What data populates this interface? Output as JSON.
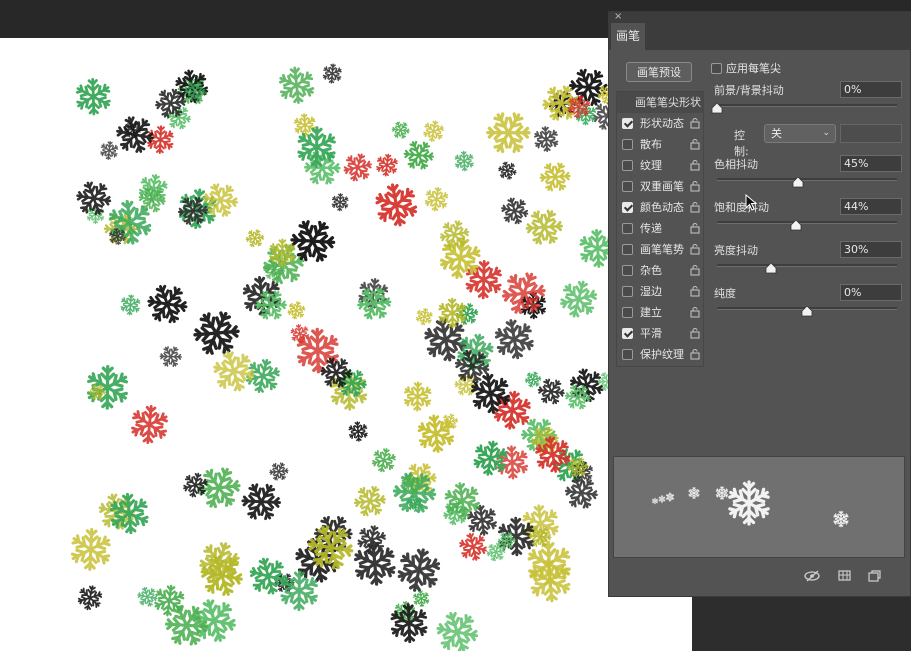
{
  "panel": {
    "tab_title": "画笔",
    "close_glyph": "×",
    "preset_button": "画笔预设",
    "brush_tip_shape": "画笔笔尖形状",
    "items": [
      {
        "label": "形状动态",
        "checked": true
      },
      {
        "label": "散布",
        "checked": false
      },
      {
        "label": "纹理",
        "checked": false
      },
      {
        "label": "双重画笔",
        "checked": false
      },
      {
        "label": "颜色动态",
        "checked": true
      },
      {
        "label": "传递",
        "checked": false
      },
      {
        "label": "画笔笔势",
        "checked": false
      },
      {
        "label": "杂色",
        "checked": false
      },
      {
        "label": "湿边",
        "checked": false
      },
      {
        "label": "建立",
        "checked": false
      },
      {
        "label": "平滑",
        "checked": true
      },
      {
        "label": "保护纹理",
        "checked": false
      }
    ],
    "apply_per_tip": "应用每笔尖",
    "fg_bg_jitter": {
      "label": "前景/背景抖动",
      "value": "0%",
      "level": 0
    },
    "control": {
      "label": "控制:",
      "value": "关"
    },
    "hue_jitter": {
      "label": "色相抖动",
      "value": "45%",
      "level": 0.45
    },
    "saturation_jitter": {
      "label": "饱和度抖动",
      "value": "44%",
      "level": 0.44
    },
    "brightness_jitter": {
      "label": "亮度抖动",
      "value": "30%",
      "level": 0.3
    },
    "purity": {
      "label": "纯度",
      "value": "0%",
      "level": 0.5
    }
  },
  "snow_colors": [
    "#2f2f2f",
    "#4caf50",
    "#d7342d",
    "#b5b92a",
    "#5bbf6a",
    "#1a1a1a",
    "#c9c23a",
    "#3aa85a"
  ],
  "icons": {
    "toggle_preview": "eye-slash-icon",
    "grid": "grid-icon",
    "new_preset": "new-brush-icon",
    "lock": "lock-icon"
  }
}
